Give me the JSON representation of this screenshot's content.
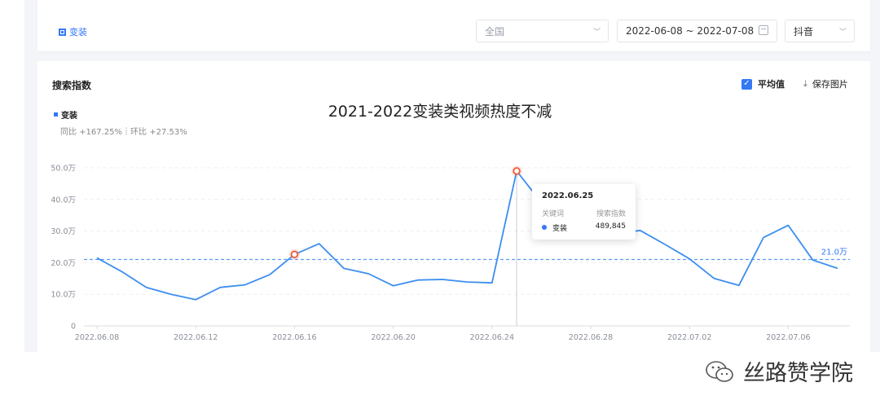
{
  "filters": {
    "keyword_tag": "变装",
    "region": "全国",
    "date_range": "2022-06-08 ~ 2022-07-08",
    "platform": "抖音"
  },
  "panel": {
    "section_title": "搜索指数",
    "avg_label": "平均值",
    "avg_checked": true,
    "save_label": "保存图片",
    "legend_keyword": "变装",
    "yoy_text": "同比 +167.25%｜环比 +27.53%"
  },
  "chart_data": {
    "type": "line",
    "title": "2021-2022变装类视频热度不减",
    "ylim": [
      0,
      500000
    ],
    "y_ticks": [
      0,
      100000,
      200000,
      300000,
      400000,
      500000
    ],
    "y_tick_labels": [
      "0",
      "10.0万",
      "20.0万",
      "30.0万",
      "40.0万",
      "50.0万"
    ],
    "x": [
      "2022.06.08",
      "2022.06.09",
      "2022.06.10",
      "2022.06.11",
      "2022.06.12",
      "2022.06.13",
      "2022.06.14",
      "2022.06.15",
      "2022.06.16",
      "2022.06.17",
      "2022.06.18",
      "2022.06.19",
      "2022.06.20",
      "2022.06.21",
      "2022.06.22",
      "2022.06.23",
      "2022.06.24",
      "2022.06.25",
      "2022.06.26",
      "2022.06.27",
      "2022.06.28",
      "2022.06.29",
      "2022.06.30",
      "2022.07.01",
      "2022.07.02",
      "2022.07.03",
      "2022.07.04",
      "2022.07.05",
      "2022.07.06",
      "2022.07.07",
      "2022.07.08"
    ],
    "x_tick_labels": [
      "2022.06.08",
      "2022.06.12",
      "2022.06.16",
      "2022.06.20",
      "2022.06.24",
      "2022.06.28",
      "2022.07.02",
      "2022.07.06"
    ],
    "series": [
      {
        "name": "变装",
        "color": "#3b8ef0",
        "values": [
          215000,
          172000,
          122000,
          100000,
          83000,
          122000,
          130000,
          162000,
          226000,
          260000,
          182000,
          165000,
          127000,
          145000,
          147000,
          139000,
          136000,
          489845,
          390000,
          330000,
          310000,
          290000,
          302000,
          258000,
          212000,
          150000,
          128000,
          280000,
          318000,
          208000,
          182000
        ]
      }
    ],
    "average": 210000,
    "average_label": "21.0万",
    "highlighted_points": [
      "2022.06.16",
      "2022.06.25"
    ],
    "grid": true
  },
  "tooltip": {
    "date": "2022.06.25",
    "col_keyword": "关键词",
    "col_index": "搜索指数",
    "keyword": "变装",
    "value": "489,845"
  },
  "watermark": {
    "text": "丝路赞学院",
    "icon": "wechat-icon"
  }
}
